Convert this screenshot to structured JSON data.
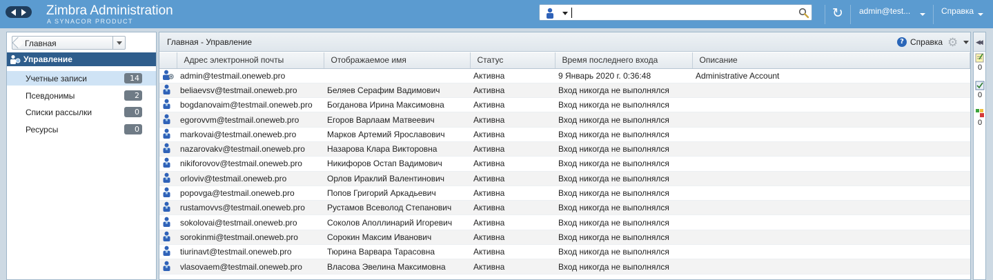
{
  "header": {
    "brand_title": "Zimbra Administration",
    "brand_subtitle": "A SYNACOR PRODUCT",
    "search_value": "",
    "user": "admin@test...",
    "help": "Справка"
  },
  "sidebar": {
    "breadcrumb": "Главная",
    "section": "Управление",
    "items": [
      {
        "label": "Учетные записи",
        "count": "14"
      },
      {
        "label": "Псевдонимы",
        "count": "2"
      },
      {
        "label": "Списки рассылки",
        "count": "0"
      },
      {
        "label": "Ресурсы",
        "count": "0"
      }
    ]
  },
  "main": {
    "title": "Главная - Управление",
    "help": "Справка",
    "columns": [
      "Адрес электронной почты",
      "Отображаемое имя",
      "Статус",
      "Время последнего входа",
      "Описание"
    ],
    "rows": [
      {
        "email": "admin@testmail.oneweb.pro",
        "name": "",
        "status": "Активна",
        "last_login": "9 Январь 2020 г. 0:36:48",
        "description": "Administrative Account",
        "admin": true
      },
      {
        "email": "beliaevsv@testmail.oneweb.pro",
        "name": "Беляев Серафим Вадимович",
        "status": "Активна",
        "last_login": "Вход никогда не выполнялся",
        "description": ""
      },
      {
        "email": "bogdanovaim@testmail.oneweb.pro",
        "name": "Богданова Ирина Максимовна",
        "status": "Активна",
        "last_login": "Вход никогда не выполнялся",
        "description": ""
      },
      {
        "email": "egorovvm@testmail.oneweb.pro",
        "name": "Егоров Варлаам Матвеевич",
        "status": "Активна",
        "last_login": "Вход никогда не выполнялся",
        "description": ""
      },
      {
        "email": "markovai@testmail.oneweb.pro",
        "name": "Марков Артемий Ярославович",
        "status": "Активна",
        "last_login": "Вход никогда не выполнялся",
        "description": ""
      },
      {
        "email": "nazarovakv@testmail.oneweb.pro",
        "name": "Назарова Клара Викторовна",
        "status": "Активна",
        "last_login": "Вход никогда не выполнялся",
        "description": ""
      },
      {
        "email": "nikiforovov@testmail.oneweb.pro",
        "name": "Никифоров Остап Вадимович",
        "status": "Активна",
        "last_login": "Вход никогда не выполнялся",
        "description": ""
      },
      {
        "email": "orloviv@testmail.oneweb.pro",
        "name": "Орлов Ираклий Валентинович",
        "status": "Активна",
        "last_login": "Вход никогда не выполнялся",
        "description": ""
      },
      {
        "email": "popovga@testmail.oneweb.pro",
        "name": "Попов Григорий Аркадьевич",
        "status": "Активна",
        "last_login": "Вход никогда не выполнялся",
        "description": ""
      },
      {
        "email": "rustamovvs@testmail.oneweb.pro",
        "name": "Рустамов Всеволод Степанович",
        "status": "Активна",
        "last_login": "Вход никогда не выполнялся",
        "description": ""
      },
      {
        "email": "sokolovai@testmail.oneweb.pro",
        "name": "Соколов Аполлинарий Игоревич",
        "status": "Активна",
        "last_login": "Вход никогда не выполнялся",
        "description": ""
      },
      {
        "email": "sorokinmi@testmail.oneweb.pro",
        "name": "Сорокин Максим Иванович",
        "status": "Активна",
        "last_login": "Вход никогда не выполнялся",
        "description": ""
      },
      {
        "email": "tiurinavt@testmail.oneweb.pro",
        "name": "Тюрина Варвара Тарасовна",
        "status": "Активна",
        "last_login": "Вход никогда не выполнялся",
        "description": ""
      },
      {
        "email": "vlasovaem@testmail.oneweb.pro",
        "name": "Власова Эвелина Максимовна",
        "status": "Активна",
        "last_login": "Вход никогда не выполнялся",
        "description": ""
      }
    ]
  },
  "rightstrip": {
    "counts": [
      "0",
      "0",
      "0"
    ]
  },
  "icons": {
    "person": "person-icon",
    "admin": "admin-person-icon",
    "search": "magnifier-icon",
    "refresh": "refresh-icon",
    "help": "help-icon",
    "gear": "gear-icon"
  }
}
